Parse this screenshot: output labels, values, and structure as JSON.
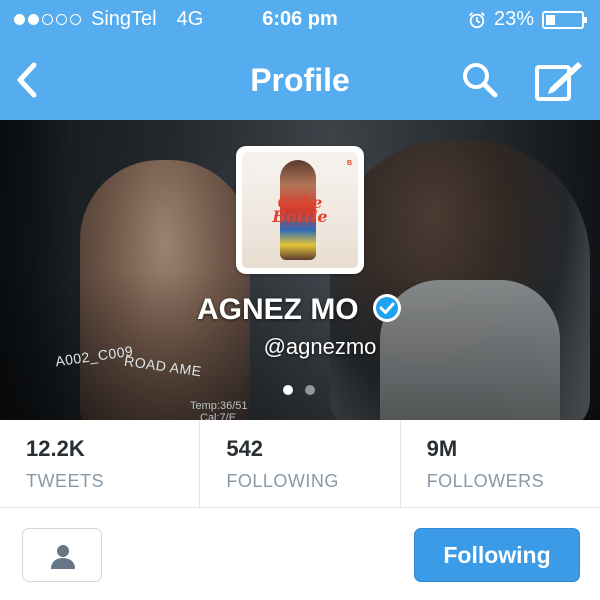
{
  "status_bar": {
    "carrier": "SingTel",
    "network": "4G",
    "time": "6:06 pm",
    "battery": "23%",
    "signal_strength": 2,
    "signal_max": 5,
    "battery_level": 0.23
  },
  "nav": {
    "title": "Profile",
    "back_icon": "chevron-left-icon",
    "search_icon": "search-icon",
    "compose_icon": "compose-icon"
  },
  "profile": {
    "name": "AGNEZ MO",
    "handle": "@agnezmo",
    "verified": true,
    "banner_text": [
      "A002_C009",
      "ROAD AME",
      "Temp:36/51",
      "Cal:7/E"
    ],
    "avatar_text": {
      "title": "Coke Bottle"
    },
    "header_page": 1,
    "header_pages": 2
  },
  "stats": [
    {
      "value": "12.2K",
      "label": "TWEETS"
    },
    {
      "value": "542",
      "label": "FOLLOWING"
    },
    {
      "value": "9M",
      "label": "FOLLOWERS"
    }
  ],
  "actions": {
    "user_icon": "person-icon",
    "follow_label": "Following"
  },
  "colors": {
    "brand": "#55acee",
    "button": "#3b9be6",
    "verified": "#1da1f2",
    "muted": "#8899a6",
    "text": "#292f33"
  }
}
